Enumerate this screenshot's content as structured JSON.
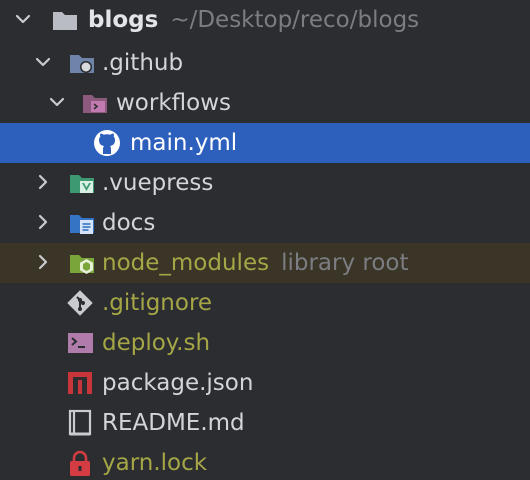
{
  "tree": {
    "root": {
      "name": "blogs",
      "path": "~/Desktop/reco/blogs"
    },
    "items": [
      {
        "label": ".github"
      },
      {
        "label": "workflows"
      },
      {
        "label": "main.yml"
      },
      {
        "label": ".vuepress"
      },
      {
        "label": "docs"
      },
      {
        "label": "node_modules",
        "hint": "library root"
      },
      {
        "label": ".gitignore"
      },
      {
        "label": "deploy.sh"
      },
      {
        "label": "package.json"
      },
      {
        "label": "README.md"
      },
      {
        "label": "yarn.lock"
      }
    ]
  },
  "colors": {
    "background": "#2b2d30",
    "selection": "#2d5fbd",
    "excluded_row": "#3a3527",
    "ignored_text": "#a5a646",
    "hint_text": "#7b7d82"
  },
  "icons": {
    "expanded": "chevron-down-icon",
    "collapsed": "chevron-right-icon",
    "folder": "folder-icon",
    "github": "github-icon",
    "vue": "vue-icon",
    "docs": "document-icon",
    "node": "nodejs-icon",
    "git": "git-icon",
    "shell": "terminal-icon",
    "npm": "npm-icon",
    "readme": "book-icon",
    "lock": "lock-icon"
  }
}
